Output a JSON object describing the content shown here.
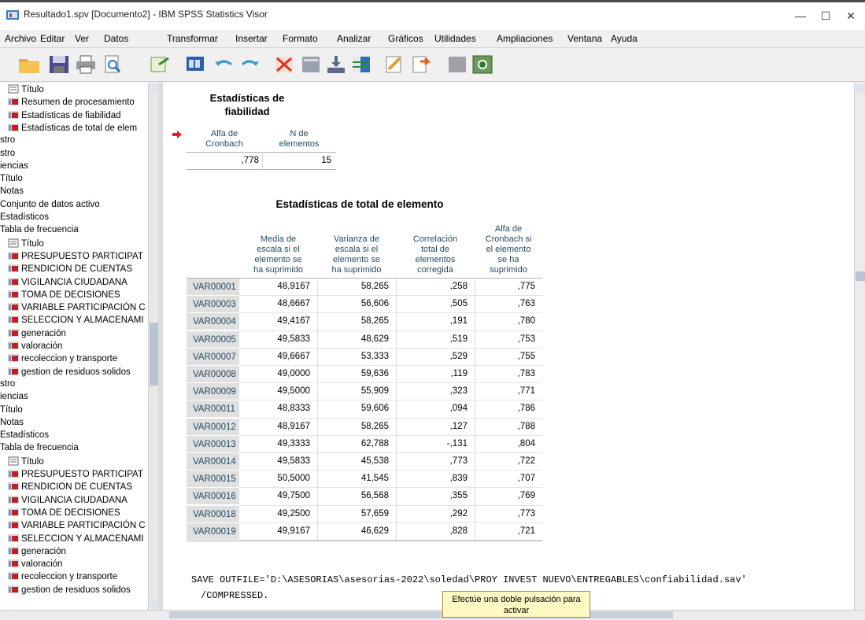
{
  "window": {
    "title": "Resultado1.spv [Documento2] - IBM SPSS Statistics Visor"
  },
  "menu": [
    "Archivo",
    "Editar",
    "Ver",
    "Datos",
    "Transformar",
    "Insertar",
    "Formato",
    "Analizar",
    "Gráficos",
    "Utilidades",
    "Ampliaciones",
    "Ventana",
    "Ayuda"
  ],
  "outline": [
    "Título",
    "Resumen de procesamiento",
    "Estadísticas de fiabilidad",
    "Estadísticas de total de elem",
    "stro",
    "stro",
    "iencias",
    "Título",
    "Notas",
    "Conjunto de datos activo",
    "Estadísticos",
    "Tabla de frecuencia",
    "Título",
    "PRESUPUESTO PARTICIPAT",
    "RENDICION DE CUENTAS",
    "VIGILANCIA CIUDADANA",
    "TOMA DE DECISIONES",
    "VARIABLE PARTICIPACIÓN C",
    "SELECCION Y ALMACENAMI",
    "generación",
    "valoración",
    "recoleccion y transporte",
    "gestion de residuos solidos",
    "stro",
    "iencias",
    "Título",
    "Notas",
    "Estadísticos",
    "Tabla de frecuencia",
    "Título",
    "PRESUPUESTO PARTICIPAT",
    "RENDICION DE CUENTAS",
    "VIGILANCIA CIUDADANA",
    "TOMA DE DECISIONES",
    "VARIABLE PARTICIPACIÓN C",
    "SELECCION Y ALMACENAMI",
    "generación",
    "valoración",
    "recoleccion y transporte",
    "gestion de residuos solidos"
  ],
  "reliability": {
    "title_line1": "Estadísticas de",
    "title_line2": "fiabilidad",
    "h1_line1": "Alfa de",
    "h1_line2": "Cronbach",
    "h2_line1": "N de",
    "h2_line2": "elementos",
    "alpha": ",778",
    "n": "15"
  },
  "itemtotal": {
    "title": "Estadísticas de total de elemento",
    "headers": [
      [
        "Media de",
        "escala si el",
        "elemento se",
        "ha suprimido"
      ],
      [
        "Varianza de",
        "escala si el",
        "elemento se",
        "ha suprimido"
      ],
      [
        "Correlación",
        "total de",
        "elementos",
        "corregida"
      ],
      [
        "Alfa de",
        "Cronbach si",
        "el elemento",
        "se ha",
        "suprimido"
      ]
    ],
    "rows": [
      [
        "VAR00001",
        "48,9167",
        "58,265",
        ",258",
        ",775"
      ],
      [
        "VAR00003",
        "48,6667",
        "56,606",
        ",505",
        ",763"
      ],
      [
        "VAR00004",
        "49,4167",
        "58,265",
        ",191",
        ",780"
      ],
      [
        "VAR00005",
        "49,5833",
        "48,629",
        ",519",
        ",753"
      ],
      [
        "VAR00007",
        "49,6667",
        "53,333",
        ",529",
        ",755"
      ],
      [
        "VAR00008",
        "49,0000",
        "59,636",
        ",119",
        ",783"
      ],
      [
        "VAR00009",
        "49,5000",
        "55,909",
        ",323",
        ",771"
      ],
      [
        "VAR00011",
        "48,8333",
        "59,606",
        ",094",
        ",786"
      ],
      [
        "VAR00012",
        "48,9167",
        "58,265",
        ",127",
        ",788"
      ],
      [
        "VAR00013",
        "49,3333",
        "62,788",
        "-,131",
        ",804"
      ],
      [
        "VAR00014",
        "49,5833",
        "45,538",
        ",773",
        ",722"
      ],
      [
        "VAR00015",
        "50,5000",
        "41,545",
        ",839",
        ",707"
      ],
      [
        "VAR00016",
        "49,7500",
        "56,568",
        ",355",
        ",769"
      ],
      [
        "VAR00018",
        "49,2500",
        "57,659",
        ",292",
        ",773"
      ],
      [
        "VAR00019",
        "49,9167",
        "46,629",
        ",828",
        ",721"
      ]
    ]
  },
  "syntax": {
    "line1": "SAVE OUTFILE='D:\\ASESORIAS\\asesorias-2022\\soledad\\PROY INVEST NUEVO\\ENTREGABLES\\confiabilidad.sav'",
    "line2": "/COMPRESSED."
  },
  "tooltip": {
    "line1": "Efectúe una doble pulsación para",
    "line2": "activar"
  },
  "colors": {
    "header_text": "#264a60",
    "row_label_bg": "#e0e0e0",
    "tooltip_bg": "#fff9c4",
    "arrow": "#e02020"
  }
}
